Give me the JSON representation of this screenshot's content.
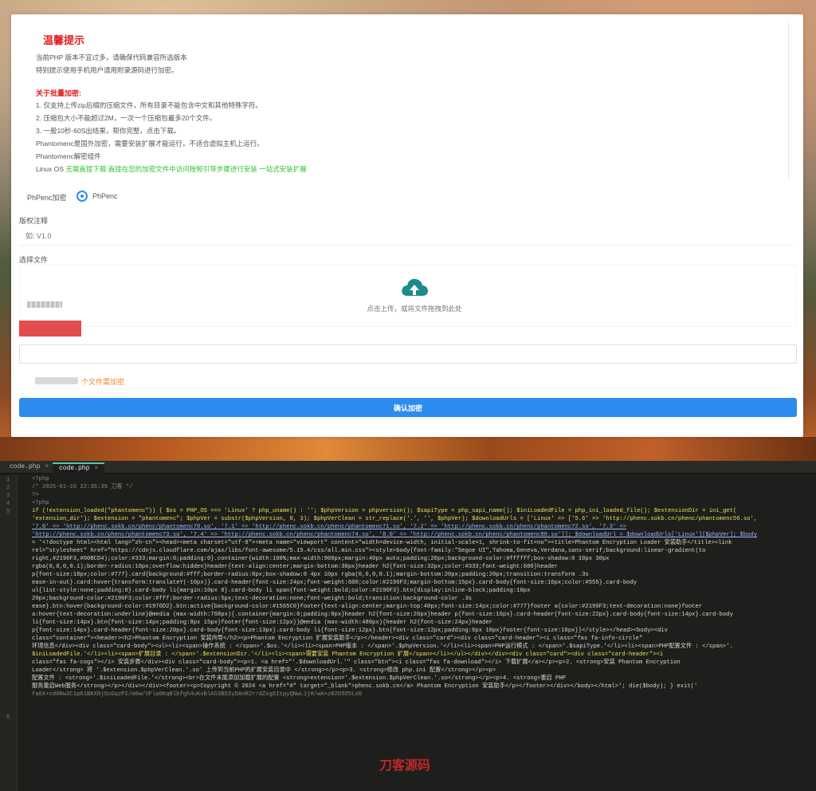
{
  "notice": {
    "title": "温馨提示",
    "line1": "当前PHP 版本不宜过多，请确保代码兼容所选版本",
    "line2": "特别提示使用手机用户请用附录源码进行加密。",
    "batch_title": "关于批量加密:",
    "item1": "1. 仅支持上传zip后缀的压缩文件，所有目录不能包含中文和其他特殊字符。",
    "item2": "2. 压缩包大小不能超过2M，一次一个压缩包最多20个文件。",
    "item3": "3. 一般10秒-60S出结果，帮你完整，点击下载。",
    "item4": "Phantomenc是国外加密，需要安装扩展才能运行，不适合虚拟主机上运行。",
    "item5": "Phantomenc解密组件",
    "linux_prefix": "Linux OS",
    "linux_text": "无需直接下载 直接在您的加密文件中访问按照引导步骤进行安装 一站式安装扩展"
  },
  "encrypt": {
    "label": "PhPenc加密",
    "option": "PhPenc"
  },
  "version": {
    "label": "版权注释",
    "placeholder": "如: V1.0"
  },
  "upload": {
    "label": "选择文件",
    "drop_text": "点击上传，或将文件拖拽到此处"
  },
  "count_text": "个文件需加密",
  "confirm_label": "确认加密",
  "editor": {
    "tabs": [
      {
        "label": "code.php",
        "active": false
      },
      {
        "label": "code.php",
        "active": true
      }
    ],
    "line_numbers": [
      "1",
      "2",
      "3",
      "4",
      "5",
      "6"
    ],
    "lines": [
      "<?php",
      "/* 2025-01-16 22:36:39 刀客 */",
      "?>",
      "<?php",
      "if (!extension_loaded(\"phantomenc\")) { $os = PHP_OS === 'Linux' ? php_uname() : ''; $phpVersion = phpversion(); $sapiType = php_sapi_name(); $iniLoadedFile = php_ini_loaded_file(); $extensionDir = ini_get(",
      "'extension_dir'); $extension = \"phantomenc\"; $phpVer = substr($phpVersion, 0, 3); $phpVerClean = str_replace('.', '', $phpVer); $downloadUrls = ['Linux' => ['5.6' => 'http://phenc.sokb.cn/phenc/phantomenc56.so',",
      "'7.0' => 'http://phenc.sokb.cn/phenc/phantomenc70.so', '7.1' => 'http://phenc.sokb.cn/phenc/phantomenc71.so', '7.2' => 'http://phenc.sokb.cn/phenc/phantomenc72.so', '7.3' =>",
      "'http://phenc.sokb.cn/phenc/phantomenc73.so', '7.4' => 'http://phenc.sokb.cn/phenc/phantomenc74.so', '8.0' => 'http://phenc.sokb.cn/phenc/phantomenc80.so']]; $downloadUrl = $downloadUrls['Linux'][$phpVer]; $body",
      "= '<!doctype html><html lang=\"zh-cn\"><head><meta charset=\"utf-8\"><meta name=\"viewport\" content=\"width=device-width, initial-scale=1, shrink-to-fit=no\"><title>Phantom Encryption Loader 安装助手</title><link",
      "rel=\"stylesheet\" href=\"https://cdnjs.cloudflare.com/ajax/libs/font-awesome/5.15.4/css/all.min.css\"><style>body{font-family:\"Segoe UI\",Tahoma,Geneva,Verdana,sans-serif;background:linear-gradient(to",
      "right,#2196F3,#00BCD4);color:#333;margin:0;padding:0}.container{width:100%;max-width:900px;margin:40px auto;padding:20px;background-color:#ffffff;box-shadow:0 10px 30px",
      "rgba(0,0,0,0.1);border-radius:10px;overflow:hidden}header{text-align:center;margin-bottom:30px}header h2{font-size:32px;color:#333;font-weight:600}header",
      "p{font-size:18px;color:#777}.card{background:#fff;border-radius:8px;box-shadow:0 4px 10px rgba(0,0,0,0.1);margin-bottom:20px;padding:20px;transition:transform .3s",
      "ease-in-out}.card:hover{transform:translateY(-10px)}.card-header{font-size:24px;font-weight:600;color:#2196F3;margin-bottom:15px}.card-body{font-size:16px;color:#555}.card-body",
      "ul{list-style:none;padding:0}.card-body li{margin:10px 0}.card-body li span{font-weight:bold;color:#2196F3}.btn{display:inline-block;padding:10px",
      "20px;background-color:#2196F3;color:#fff;border-radius:5px;text-decoration:none;font-weight:bold;transition:background-color .3s",
      "ease}.btn:hover{background-color:#1976D2}.btn:active{background-color:#1565C0}footer{text-align:center;margin-top:40px;font-size:14px;color:#777}footer a{color:#2196F3;text-decoration:none}footer",
      "a:hover{text-decoration:underline}@media (max-width:768px){.container{margin:0;padding:0px}header h2{font-size:26px}header p{font-size:16px}.card-header{font-size:22px}.card-body{font-size:14px}.card-body",
      "li{font-size:14px}.btn{font-size:14px;padding:8px 15px}footer{font-size:12px}}@media (max-width:480px){header h2{font-size:24px}header",
      "p{font-size:14px}.card-header{font-size:20px}.card-body{font-size:13px}.card-body li{font-size:12px}.btn{font-size:12px;padding:6px 10px}footer{font-size:10px}}</style></head><body><div",
      "class=\"container\"><header><h2>Phantom Encryption 安装向导</h2><p>Phantom Encryption 扩展安装助手</p></header><div class=\"card\"><div class=\"card-header\"><i class=\"fas fa-info-circle\"",
      "环境信息</div><div class=\"card-body\"><ul><li><span>操作系统 : </span>'.$os.'</li><li><span>PHP版本 : </span>'.$phpVersion.'</li><li><span>PHP运行模式 : </span>'.$sapiType.'</li><li><span>PHP配置文件 : </span>'.",
      "$iniLoadedFile.'</li><li><span>扩展目录 : </span>'.$extensionDir.'</li><li><span>需要安装 Phantom Encryption 扩展</span></li></ul></div></div><div class=\"card\"><div class=\"card-header\"><i",
      "class=\"fas fa-cogs\"></i> 安装步骤</div><div class=\"card-body\"><p>1. <a href=\"'.$downloadUrl.'\" class=\"btn\"><i class=\"fas fa-download\"></i> 下载扩展</a></p><p>2. <strong>安装 Phantom Encryption",
      "Loader</strong> 将 '.$extension.$phpVerClean.'.so' 上传到当前PHP的扩展安装目录中 </strong></p><p>3. <strong>修改 php.ini 配置</strong></p><p>",
      "配置文件 : <strong>'.$iniLoadedFile.'</strong><br>在文件末尾添加加载扩展的配置 <strong>extension='.$extension.$phpVerClean.'.so</strong></p><p>4. <strong>重启 PHP",
      "服务重启Web服务</strong></p></div></div><footer><p>Copyright © 2024 <a href=\"#\" target=\"_blank\">phenc.sokb.cn</a> Phantom Encryption 安装助手</p></footer></div></body></html>'; die($body); } exit('",
      "fa0X+cd0Rw3C1pK1BKXNjSoGqzPI/m0w/VFla0KqBlbfgh4uKvBlA53BSIyDAnR2r/dZxgSItpyQNwL1jH/wA+zB2D5O5Lo0"
    ]
  },
  "watermark": "刀客源码"
}
